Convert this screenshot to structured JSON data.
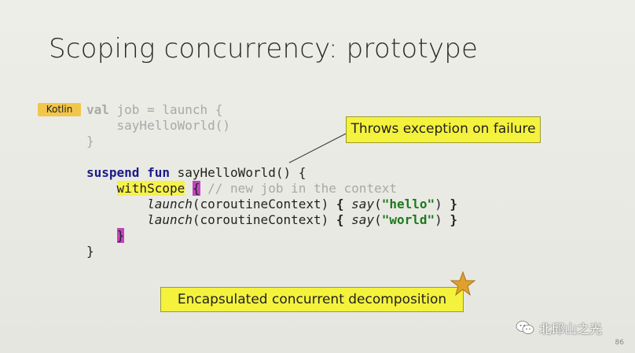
{
  "slide": {
    "title": "Scoping concurrency: prototype",
    "language_tag": "Kotlin",
    "page_number": "86"
  },
  "code": {
    "line1_kw": "val",
    "line1_rest": " job = launch {",
    "line2": "    sayHelloWorld()",
    "line3": "}",
    "line5_kw1": "suspend",
    "line5_kw2": "fun",
    "line5_rest": " sayHelloWorld() {",
    "line6_indent": "    ",
    "line6_fn": "withScope",
    "line6_brace": "{",
    "line6_comment": " // new job in the context",
    "line7_indent": "        ",
    "line7_fn": "launch",
    "line7_mid": "(coroutineContext) ",
    "line7_brace_open": "{",
    "line7_say": "say",
    "line7_paren_open": "(",
    "line7_str": "\"hello\"",
    "line7_paren_close": ") ",
    "line7_brace_close": "}",
    "line8_indent": "        ",
    "line8_fn": "launch",
    "line8_mid": "(coroutineContext) ",
    "line8_brace_open": "{",
    "line8_say": "say",
    "line8_paren_open": "(",
    "line8_str": "\"world\"",
    "line8_paren_close": ") ",
    "line8_brace_close": "}",
    "line9_indent": "    ",
    "line9_brace": "}",
    "line10": "}"
  },
  "callouts": {
    "exception": "Throws exception on failure",
    "decomposition": "Encapsulated concurrent decomposition"
  },
  "watermark": {
    "text": "北邱山之光",
    "icon": "wechat-icon"
  },
  "colors": {
    "highlight_yellow": "#f6f24a",
    "highlight_purple": "#c243c0",
    "keyword_blue": "#1a1a8a",
    "string_green": "#1d7a1d",
    "kotlin_tag": "#f2c64a",
    "star": "#e0a12a"
  }
}
